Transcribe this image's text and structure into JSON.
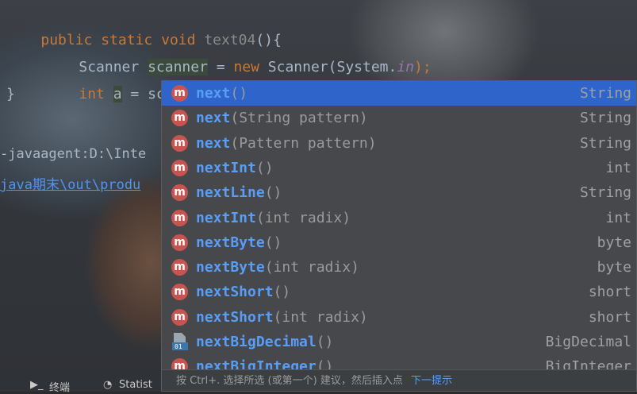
{
  "code": {
    "line1": {
      "kw1": "public",
      "kw2": "static",
      "kw3": "void",
      "name": "text04",
      "rest": "(){"
    },
    "line2": {
      "type": "Scanner",
      "var": "scanner",
      "eq": " = ",
      "kw": "new",
      "ctor": " Scanner(System.",
      "field": "in",
      "end": ");"
    },
    "line3": {
      "kw": "int",
      "var": "a",
      "rest": " = scanner.next"
    },
    "line4": "}"
  },
  "console": {
    "line1": "-javaagent:D:\\Inte",
    "line2": "java期末\\out\\produ"
  },
  "popup": {
    "items": [
      {
        "icon": "m",
        "name": "next",
        "params": "()",
        "type": "String"
      },
      {
        "icon": "m",
        "name": "next",
        "params": "(String pattern)",
        "type": "String"
      },
      {
        "icon": "m",
        "name": "next",
        "params": "(Pattern pattern)",
        "type": "String"
      },
      {
        "icon": "m",
        "name": "nextInt",
        "params": "()",
        "type": "int"
      },
      {
        "icon": "m",
        "name": "nextLine",
        "params": "()",
        "type": "String"
      },
      {
        "icon": "m",
        "name": "nextInt",
        "params": "(int radix)",
        "type": "int"
      },
      {
        "icon": "m",
        "name": "nextByte",
        "params": "()",
        "type": "byte"
      },
      {
        "icon": "m",
        "name": "nextByte",
        "params": "(int radix)",
        "type": "byte"
      },
      {
        "icon": "m",
        "name": "nextShort",
        "params": "()",
        "type": "short"
      },
      {
        "icon": "m",
        "name": "nextShort",
        "params": "(int radix)",
        "type": "short"
      },
      {
        "icon": "field-01",
        "name": "nextBigDecimal",
        "params": "()",
        "type": "BigDecimal"
      },
      {
        "icon": "m",
        "name": "nextBigInteger",
        "params": "()",
        "type": "BigInteger"
      }
    ],
    "footer_text": "按 Ctrl+. 选择所选 (或第一个) 建议，然后插入点",
    "footer_link": "下一提示"
  },
  "bottom_tabs": {
    "tab1": "终端",
    "tab2": "Statist"
  },
  "colors": {
    "accent": "#2f65ca",
    "method_icon": "#c75450",
    "keyword": "#cc7832"
  }
}
